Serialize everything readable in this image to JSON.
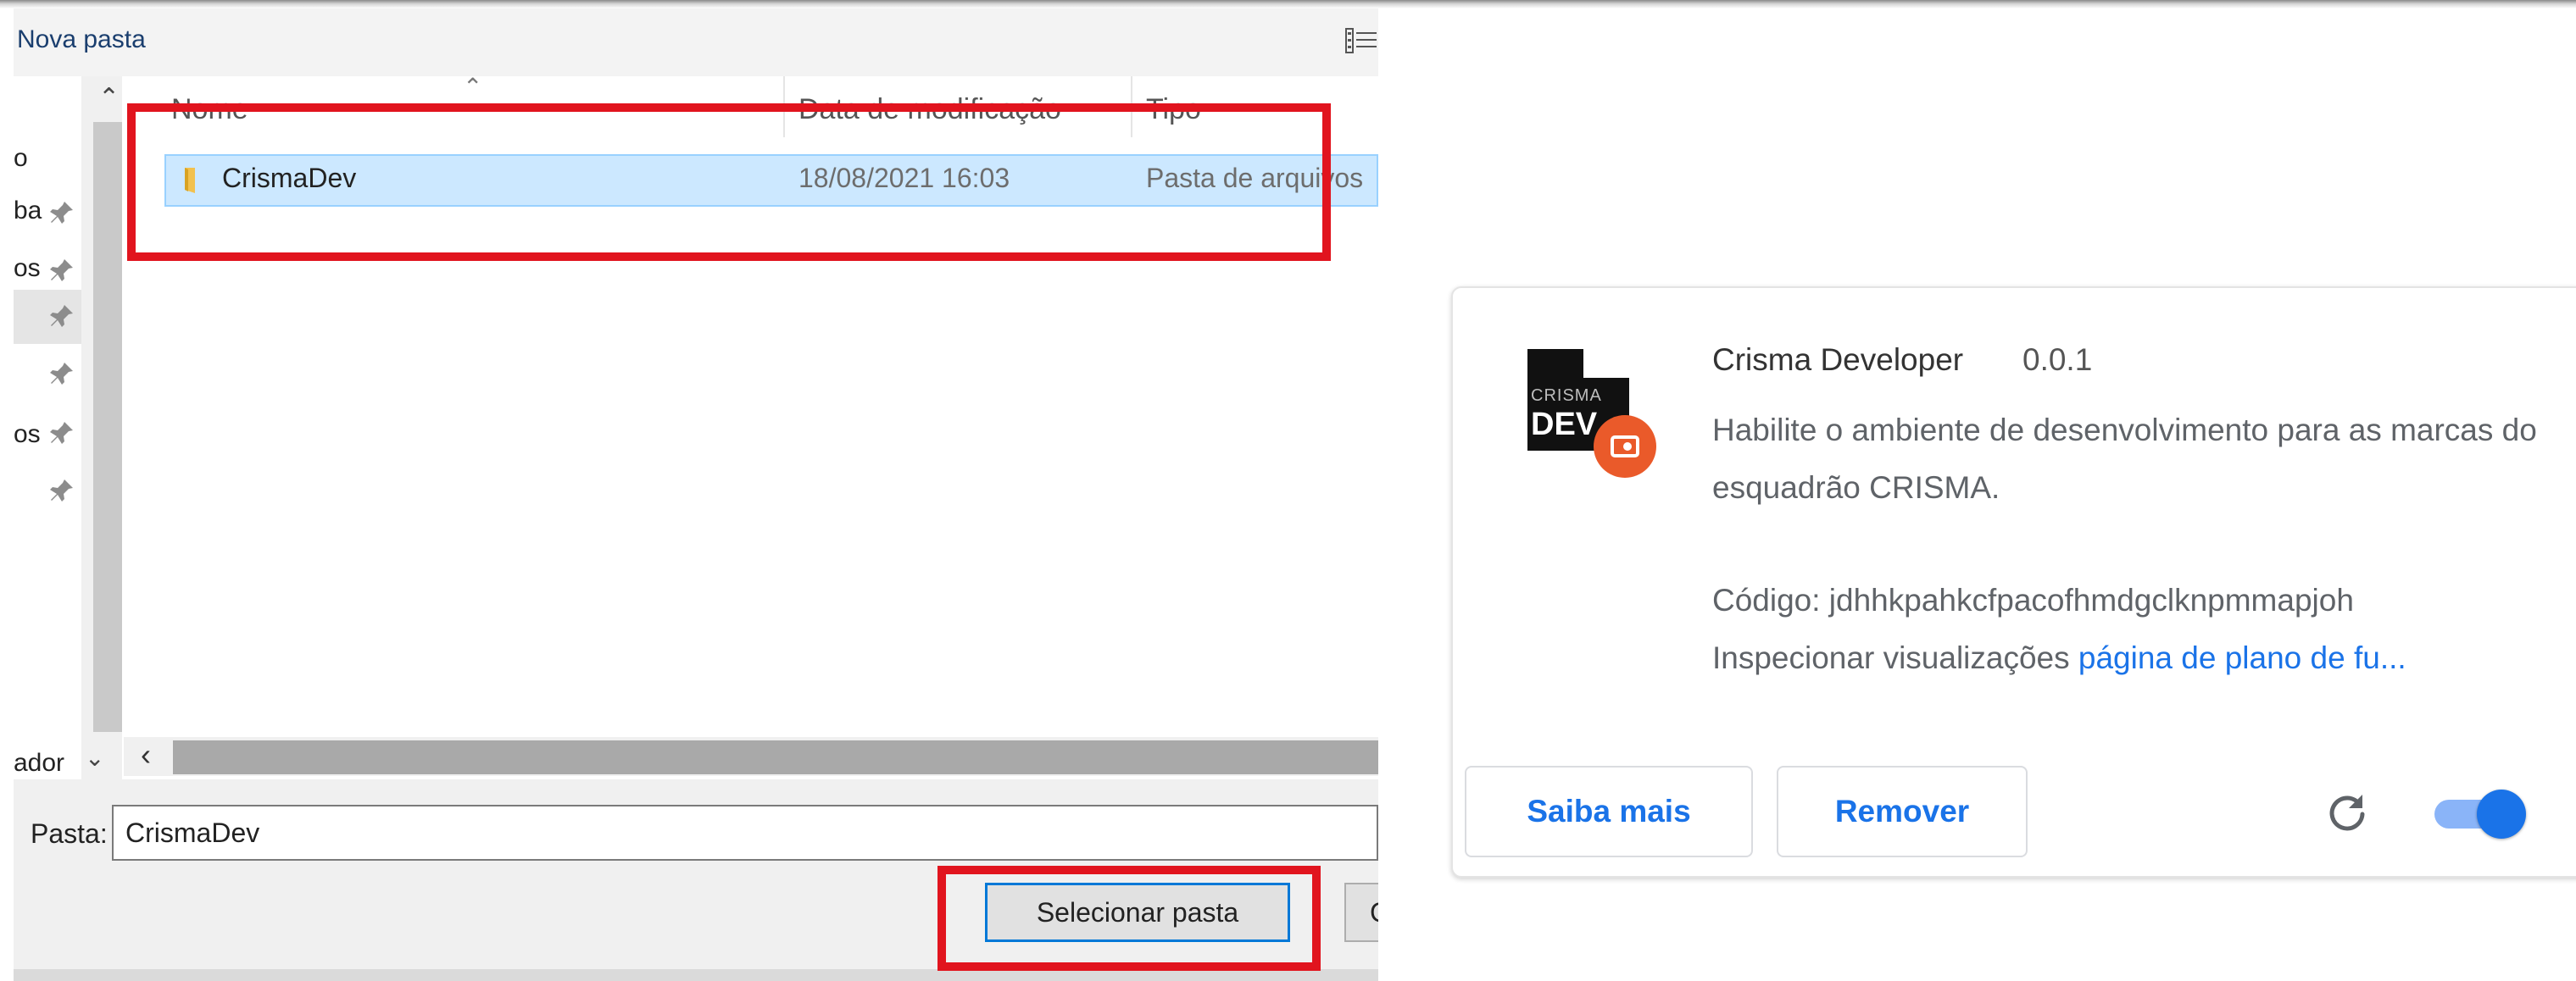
{
  "dialog": {
    "toolbar": {
      "new_folder_label": "Nova pasta",
      "view_icon": "details-view-icon"
    },
    "nav_pane": {
      "items": [
        {
          "label": "o",
          "pinned": false
        },
        {
          "label": "ba",
          "pinned": true
        },
        {
          "label": "os",
          "pinned": true
        },
        {
          "label": "",
          "pinned": true,
          "selected": true
        },
        {
          "label": "",
          "pinned": true
        },
        {
          "label": "os",
          "pinned": true
        },
        {
          "label": "",
          "pinned": true
        }
      ],
      "bottom_label": "ador"
    },
    "columns": [
      "Nome",
      "Data de modificação",
      "Tipo"
    ],
    "rows": [
      {
        "name": "CrismaDev",
        "modified": "18/08/2021 16:03",
        "type": "Pasta de arquivos",
        "selected": true
      }
    ],
    "footer": {
      "folder_label": "Pasta:",
      "folder_value": "CrismaDev",
      "select_button": "Selecionar pasta",
      "cancel_button_visible": "C"
    }
  },
  "extension": {
    "icon_text_top": "CRISMA",
    "icon_text_bottom": "DEV",
    "name": "Crisma Developer",
    "version": "0.0.1",
    "description": "Habilite o ambiente de desenvolvimento para as marcas do esquadrão CRISMA.",
    "code_line": "Código: jdhhkpahkcfpacofhmdgclknpmmapjoh",
    "inspect_label": "Inspecionar visualizações",
    "inspect_link": "página de plano de fu...",
    "buttons": {
      "learn_more": "Saiba mais",
      "remove": "Remover"
    },
    "enabled": true,
    "accent_color": "#1a73e8"
  }
}
